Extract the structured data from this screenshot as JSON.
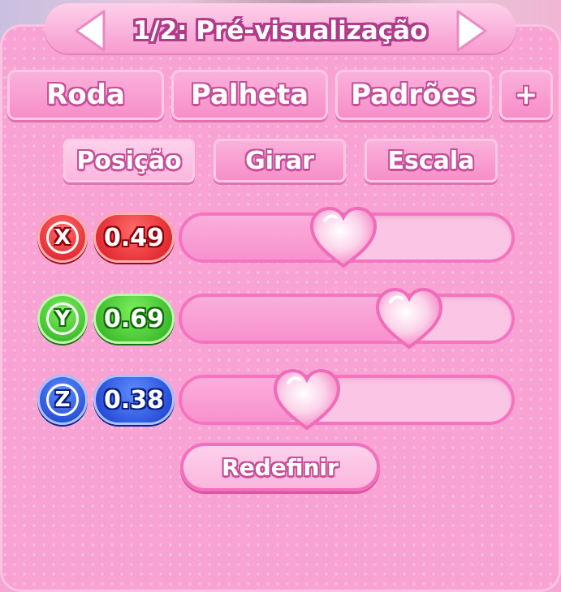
{
  "header": {
    "title": "1/2: Pré-visualização",
    "prev_icon": "triangle-left-icon",
    "next_icon": "triangle-right-icon"
  },
  "tabs": [
    {
      "label": "Roda"
    },
    {
      "label": "Palheta"
    },
    {
      "label": "Padrões"
    },
    {
      "label": "+"
    }
  ],
  "subtabs": [
    {
      "label": "Posição",
      "active": true
    },
    {
      "label": "Girar",
      "active": false
    },
    {
      "label": "Escala",
      "active": false
    }
  ],
  "sliders": [
    {
      "axis": "X",
      "value_label": "0.49",
      "level": 0.49,
      "color": "#d8121c"
    },
    {
      "axis": "Y",
      "value_label": "0.69",
      "level": 0.69,
      "color": "#26a81a"
    },
    {
      "axis": "Z",
      "value_label": "0.38",
      "level": 0.38,
      "color": "#1437c8"
    }
  ],
  "reset_button": {
    "label": "Redefinir"
  },
  "colors": {
    "panel": "#f8a3d3",
    "accent_outline": "#c54e99",
    "track_border": "#f673c0"
  }
}
